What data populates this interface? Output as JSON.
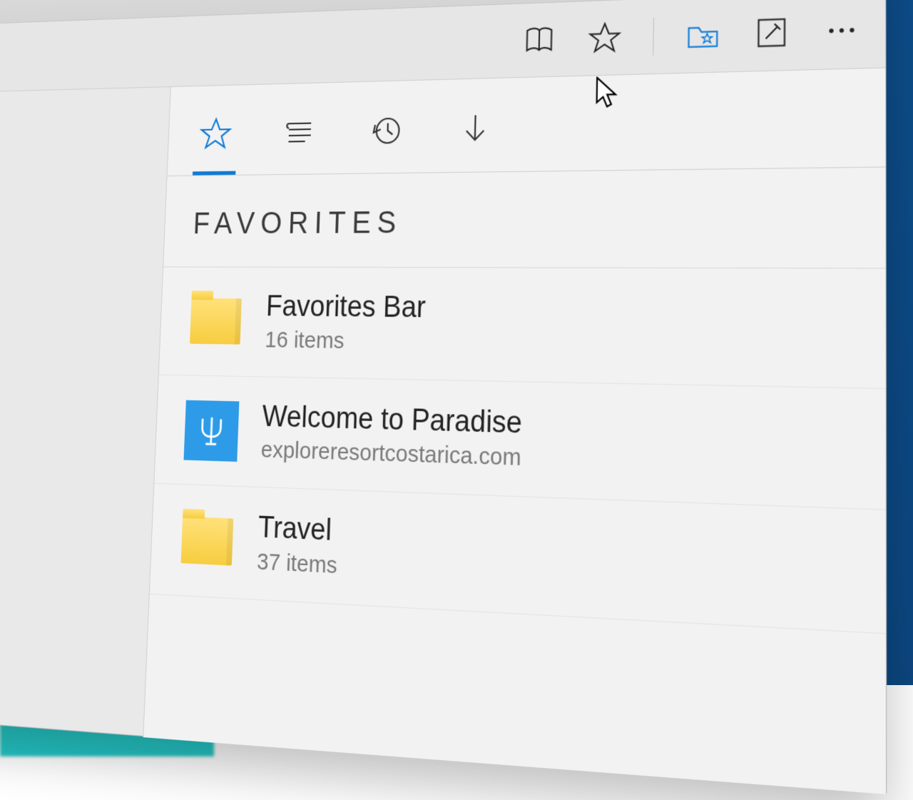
{
  "window": {
    "controls": {
      "minimize": "minimize",
      "maximize": "maximize",
      "close": "close"
    }
  },
  "toolbar": {
    "reading_view": "reading-view",
    "favorite_star": "add-favorite",
    "hub_folder": "hub",
    "note": "web-note",
    "more": "more"
  },
  "hub": {
    "tabs": {
      "favorites": "Favorites",
      "reading_list": "Reading list",
      "history": "History",
      "downloads": "Downloads",
      "active": "favorites"
    },
    "title": "FAVORITES",
    "items": [
      {
        "kind": "folder",
        "title": "Favorites Bar",
        "subtitle": "16 items"
      },
      {
        "kind": "site",
        "title": "Welcome to Paradise",
        "subtitle": "exploreresortcostarica.com",
        "icon": "trident"
      },
      {
        "kind": "folder",
        "title": "Travel",
        "subtitle": "37 items"
      }
    ]
  },
  "colors": {
    "accent": "#0e7ad6",
    "folder": "#f7cd3f",
    "site": "#2d9be8"
  }
}
